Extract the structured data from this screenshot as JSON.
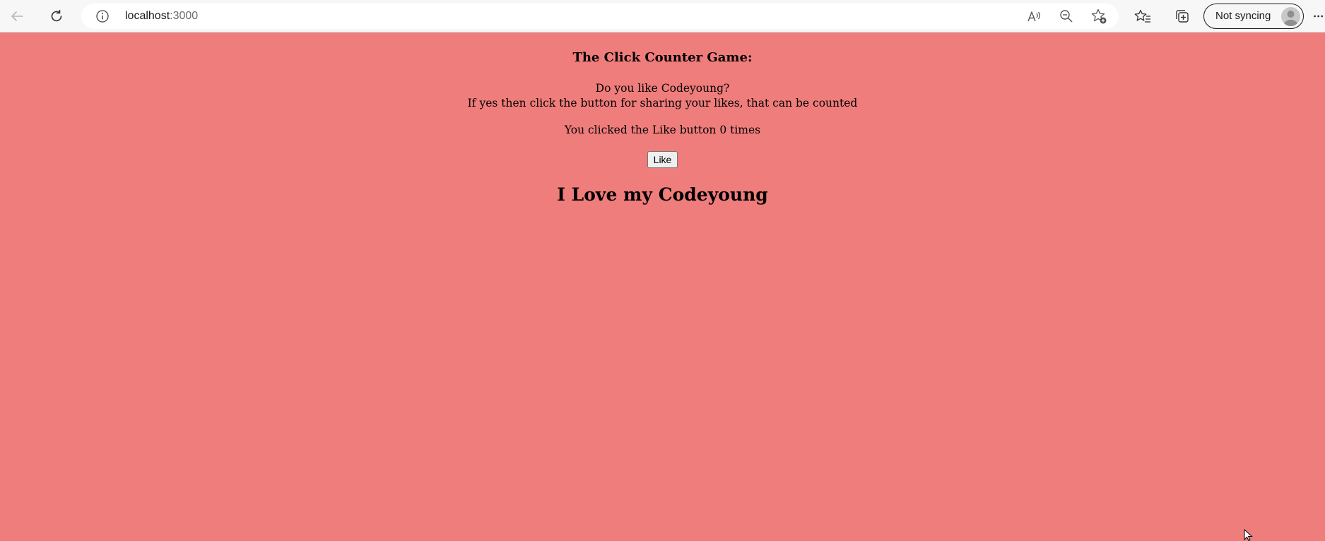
{
  "browser": {
    "url_host": "localhost",
    "url_port": ":3000",
    "profile_label": "Not syncing",
    "icons": {
      "back": "back-arrow-icon",
      "refresh": "refresh-icon",
      "info": "info-icon",
      "read_aloud": "read-aloud-icon",
      "zoom": "zoom-out-icon",
      "favorite": "add-favorite-icon",
      "favorites": "favorites-icon",
      "collections": "collections-icon",
      "more": "more-icon"
    }
  },
  "page": {
    "background_color": "#ef7d7b",
    "title": "The Click Counter Game:",
    "question_line1": "Do you like Codeyoung?",
    "question_line2": "If yes then click the button for sharing your likes, that can be counted",
    "counter_text": "You clicked the Like button 0 times",
    "like_button_label": "Like",
    "heading": "I Love my Codeyoung"
  }
}
